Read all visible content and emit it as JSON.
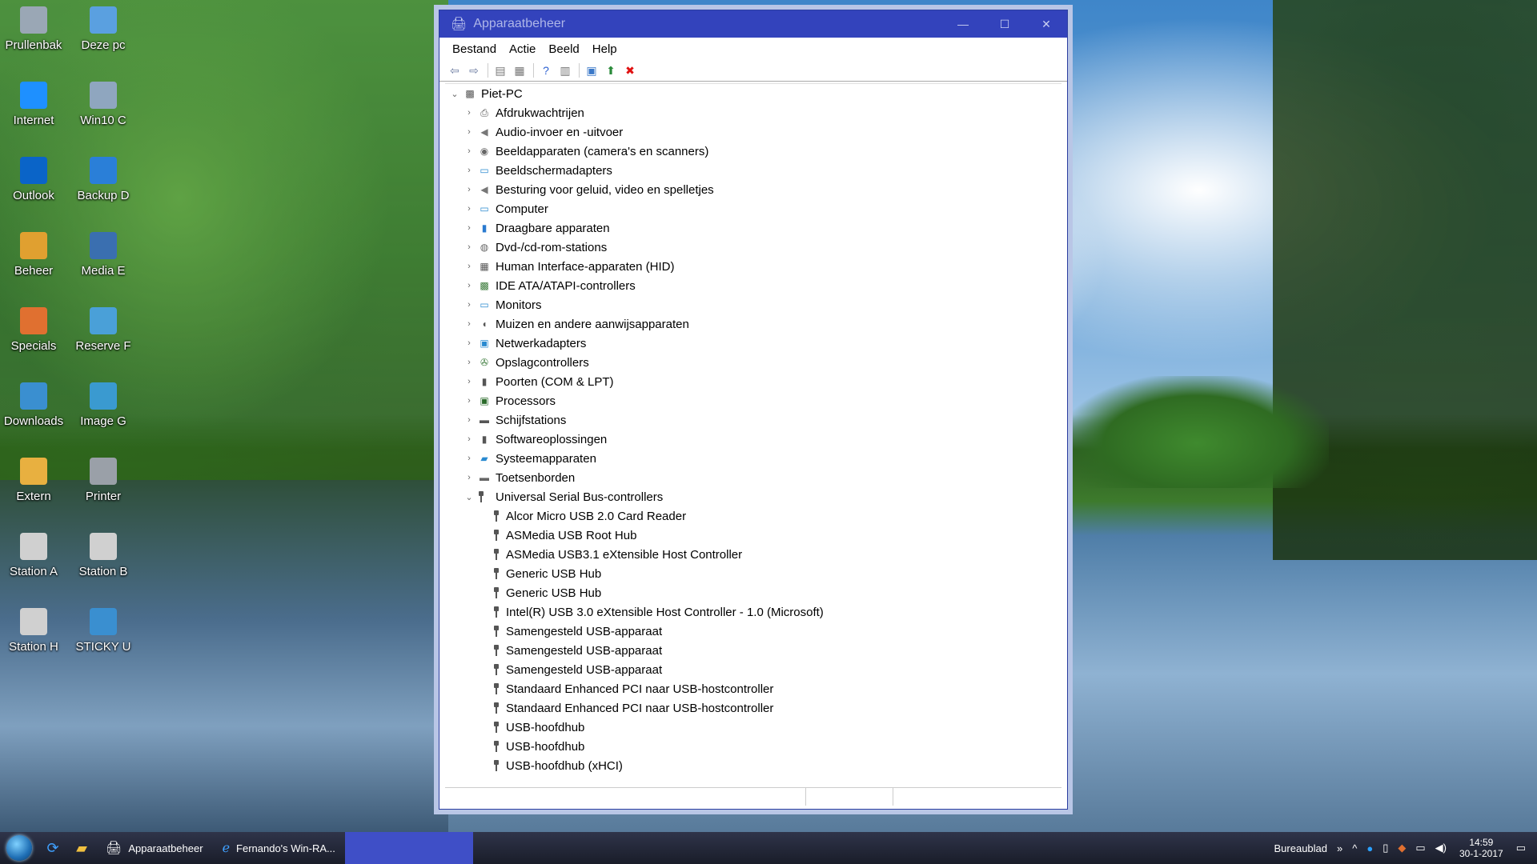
{
  "desktop": {
    "icons": [
      {
        "label": "Prullenbak",
        "icon": "recycle-bin-icon",
        "color": "#9aa7b5"
      },
      {
        "label": "Deze pc",
        "icon": "this-pc-icon",
        "color": "#5aa0e0"
      },
      {
        "label": "Internet",
        "icon": "internet-explorer-icon",
        "color": "#1e90ff"
      },
      {
        "label": "Win10 C",
        "icon": "drive-icon",
        "color": "#8fa6bf"
      },
      {
        "label": "Outlook",
        "icon": "outlook-icon",
        "color": "#0a64c8"
      },
      {
        "label": "Backup D",
        "icon": "windows-logo-icon",
        "color": "#2a7fd8"
      },
      {
        "label": "Beheer",
        "icon": "key-icon",
        "color": "#e0a030"
      },
      {
        "label": "Media E",
        "icon": "film-icon",
        "color": "#3a6fb0"
      },
      {
        "label": "Specials",
        "icon": "butterfly-icon",
        "color": "#e07030"
      },
      {
        "label": "Reserve F",
        "icon": "monitor-icon",
        "color": "#4aa0d8"
      },
      {
        "label": "Downloads",
        "icon": "downloads-icon",
        "color": "#3a8fd0"
      },
      {
        "label": "Image G",
        "icon": "image-icon",
        "color": "#3a9ad0"
      },
      {
        "label": "Extern",
        "icon": "folder-icon",
        "color": "#e8b040"
      },
      {
        "label": "Printer",
        "icon": "printer-icon",
        "color": "#9aa0a8"
      },
      {
        "label": "Station A",
        "icon": "disc-drive-icon",
        "color": "#d0d0d0"
      },
      {
        "label": "Station B",
        "icon": "disc-drive-icon",
        "color": "#d0d0d0"
      },
      {
        "label": "Station H",
        "icon": "disc-drive-icon",
        "color": "#d0d0d0"
      },
      {
        "label": "STICKY U",
        "icon": "eject-icon",
        "color": "#3a8fd0"
      }
    ]
  },
  "window": {
    "title": "Apparaatbeheer",
    "controls": {
      "minimize": "—",
      "maximize": "☐",
      "close": "✕"
    },
    "menu": [
      "Bestand",
      "Actie",
      "Beeld",
      "Help"
    ],
    "toolbar": [
      {
        "icon": "back-arrow-icon",
        "glyph": "⇦",
        "color": "#6a7aa0"
      },
      {
        "icon": "forward-arrow-icon",
        "glyph": "⇨",
        "color": "#6a7aa0"
      },
      {
        "icon": "show-hide-tree-icon",
        "glyph": "▤",
        "color": "#777"
      },
      {
        "icon": "properties-icon",
        "glyph": "▦",
        "color": "#777"
      },
      {
        "icon": "help-icon",
        "glyph": "?",
        "color": "#2a5fd0"
      },
      {
        "icon": "view-icon",
        "glyph": "▥",
        "color": "#777"
      },
      {
        "icon": "scan-hardware-icon",
        "glyph": "▣",
        "color": "#3a78c8"
      },
      {
        "icon": "update-driver-icon",
        "glyph": "⬆",
        "color": "#2a8a3a"
      },
      {
        "icon": "uninstall-icon",
        "glyph": "✖",
        "color": "#e01010"
      }
    ],
    "tree": {
      "root": {
        "label": "Piet-PC",
        "icon": "computer-icon"
      },
      "categories": [
        {
          "label": "Afdrukwachtrijen",
          "icon": "printer-queue-icon",
          "glyph": "⎙",
          "color": "#555"
        },
        {
          "label": "Audio-invoer en -uitvoer",
          "icon": "speaker-icon",
          "glyph": "◀",
          "color": "#777"
        },
        {
          "label": "Beeldapparaten (camera's en scanners)",
          "icon": "camera-icon",
          "glyph": "◉",
          "color": "#666"
        },
        {
          "label": "Beeldschermadapters",
          "icon": "display-adapter-icon",
          "glyph": "▭",
          "color": "#2a8ad0"
        },
        {
          "label": "Besturing voor geluid, video en spelletjes",
          "icon": "sound-icon",
          "glyph": "◀",
          "color": "#777"
        },
        {
          "label": "Computer",
          "icon": "computer-icon",
          "glyph": "▭",
          "color": "#2a8ad0"
        },
        {
          "label": "Draagbare apparaten",
          "icon": "portable-device-icon",
          "glyph": "▮",
          "color": "#2a7ad0"
        },
        {
          "label": "Dvd-/cd-rom-stations",
          "icon": "dvd-drive-icon",
          "glyph": "◍",
          "color": "#666"
        },
        {
          "label": "Human Interface-apparaten (HID)",
          "icon": "hid-icon",
          "glyph": "▦",
          "color": "#555"
        },
        {
          "label": "IDE ATA/ATAPI-controllers",
          "icon": "ide-controller-icon",
          "glyph": "▩",
          "color": "#3a7a3a"
        },
        {
          "label": "Monitors",
          "icon": "monitor-icon",
          "glyph": "▭",
          "color": "#2a8ad0"
        },
        {
          "label": "Muizen en andere aanwijsapparaten",
          "icon": "mouse-icon",
          "glyph": "◖",
          "color": "#555"
        },
        {
          "label": "Netwerkadapters",
          "icon": "network-adapter-icon",
          "glyph": "▣",
          "color": "#2a8ad0"
        },
        {
          "label": "Opslagcontrollers",
          "icon": "storage-controller-icon",
          "glyph": "✇",
          "color": "#3a7a3a"
        },
        {
          "label": "Poorten (COM & LPT)",
          "icon": "port-icon",
          "glyph": "▮",
          "color": "#555"
        },
        {
          "label": "Processors",
          "icon": "processor-icon",
          "glyph": "▣",
          "color": "#2a6a2a"
        },
        {
          "label": "Schijfstations",
          "icon": "disk-drive-icon",
          "glyph": "▬",
          "color": "#555"
        },
        {
          "label": "Softwareoplossingen",
          "icon": "software-icon",
          "glyph": "▮",
          "color": "#555"
        },
        {
          "label": "Systeemapparaten",
          "icon": "system-device-icon",
          "glyph": "▰",
          "color": "#2a8ad0"
        },
        {
          "label": "Toetsenborden",
          "icon": "keyboard-icon",
          "glyph": "▬",
          "color": "#666"
        }
      ],
      "expanded": {
        "label": "Universal Serial Bus-controllers",
        "icon": "usb-icon",
        "children": [
          "Alcor Micro USB 2.0 Card Reader",
          "ASMedia USB Root Hub",
          "ASMedia USB3.1 eXtensible Host Controller",
          "Generic USB Hub",
          "Generic USB Hub",
          "Intel(R) USB 3.0 eXtensible Host Controller - 1.0 (Microsoft)",
          "Samengesteld USB-apparaat",
          "Samengesteld USB-apparaat",
          "Samengesteld USB-apparaat",
          "Standaard Enhanced PCI naar USB-hostcontroller",
          "Standaard Enhanced PCI naar USB-hostcontroller",
          "USB-hoofdhub",
          "USB-hoofdhub",
          "USB-hoofdhub (xHCI)"
        ]
      }
    }
  },
  "taskbar": {
    "tasks": [
      {
        "label": "Apparaatbeheer",
        "icon": "device-manager-icon"
      },
      {
        "label": "Fernando's Win-RA...",
        "icon": "internet-explorer-icon"
      }
    ],
    "tray": {
      "desktop_label": "Bureaublad",
      "chevron": "»",
      "up_arrow": "^",
      "time": "14:59",
      "date": "30-1-2017"
    }
  }
}
